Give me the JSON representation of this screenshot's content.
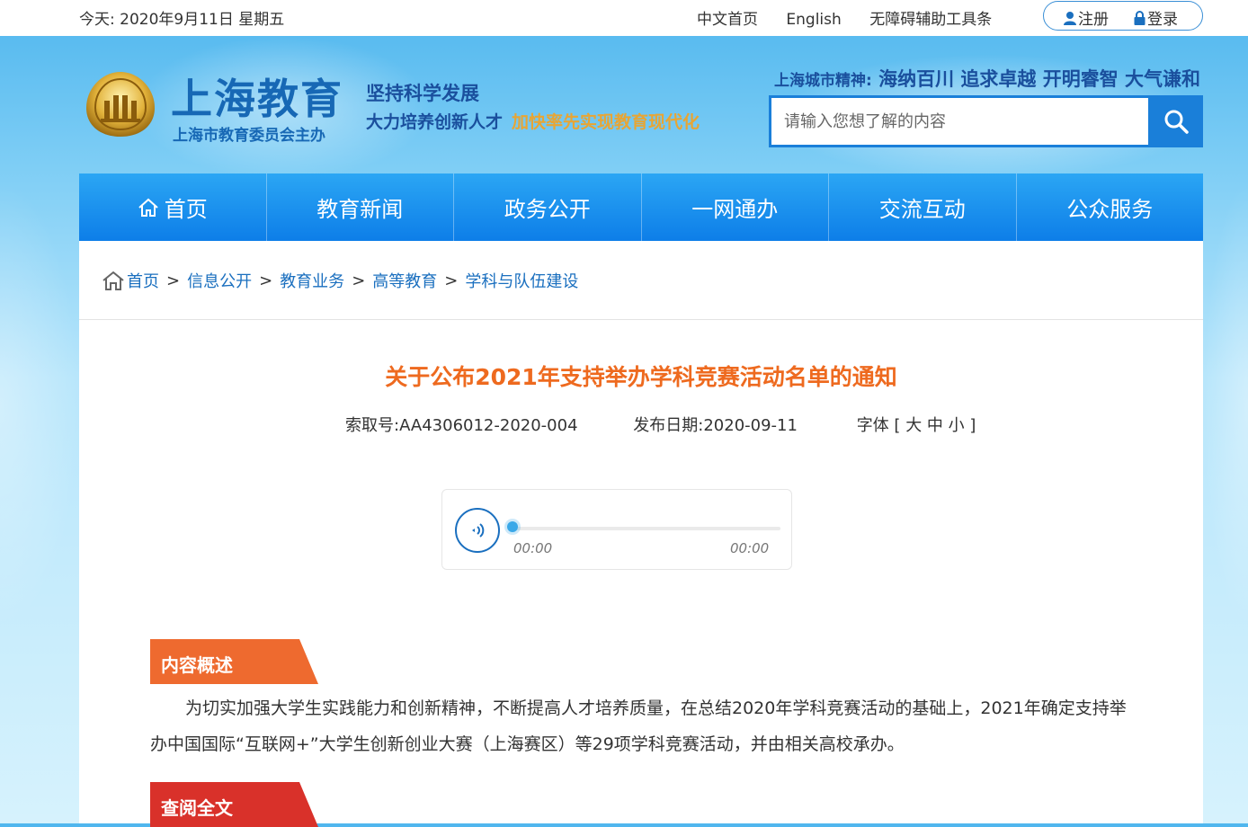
{
  "topbar": {
    "date": "今天:  2020年9月11日 星期五",
    "links": [
      "中文首页",
      "English",
      "无障碍辅助工具条"
    ],
    "register": "注册",
    "login": "登录"
  },
  "header": {
    "logo_title": "上海教育",
    "logo_sub": "上海市教育委员会主办",
    "slogan_line1": "坚持科学发展",
    "slogan_line2a": "大力培养创新人才",
    "slogan_line2b": "加快率先实现教育现代化",
    "spirit_label": "上海城市精神:",
    "spirit_text": "海纳百川 追求卓越 开明睿智 大气谦和",
    "search_placeholder": "请输入您想了解的内容"
  },
  "nav": {
    "items": [
      "首页",
      "教育新闻",
      "政务公开",
      "一网通办",
      "交流互动",
      "公众服务"
    ]
  },
  "breadcrumb": {
    "items": [
      "首页",
      "信息公开",
      "教育业务",
      "高等教育",
      "学科与队伍建设"
    ],
    "separator": ">"
  },
  "article": {
    "title": "关于公布2021年支持举办学科竞赛活动名单的通知",
    "index_label": "索取号:",
    "index_value": "AA4306012-2020-004",
    "date_label": "发布日期:",
    "date_value": "2020-09-11",
    "font_label": "字体",
    "font_open": "[",
    "font_large": "大",
    "font_medium": "中",
    "font_small": "小",
    "font_close": "]"
  },
  "player": {
    "current_time": "00:00",
    "total_time": "00:00",
    "progress": 0
  },
  "sections": {
    "summary_title": "内容概述",
    "summary_text": "为切实加强大学生实践能力和创新精神，不断提高人才培养质量，在总结2020年学科竞赛活动的基础上，2021年确定支持举办中国国际“互联网+”大学生创新创业大赛（上海赛区）等29项学科竞赛活动，并由相关高校承办。",
    "fulltext_title": "查阅全文"
  },
  "colors": {
    "nav_blue": "#0d7ee8",
    "title_orange": "#ee6a1f",
    "summary_tab": "#ee6a2f",
    "fulltext_tab": "#d9312a",
    "link_blue": "#1a6fbf"
  }
}
